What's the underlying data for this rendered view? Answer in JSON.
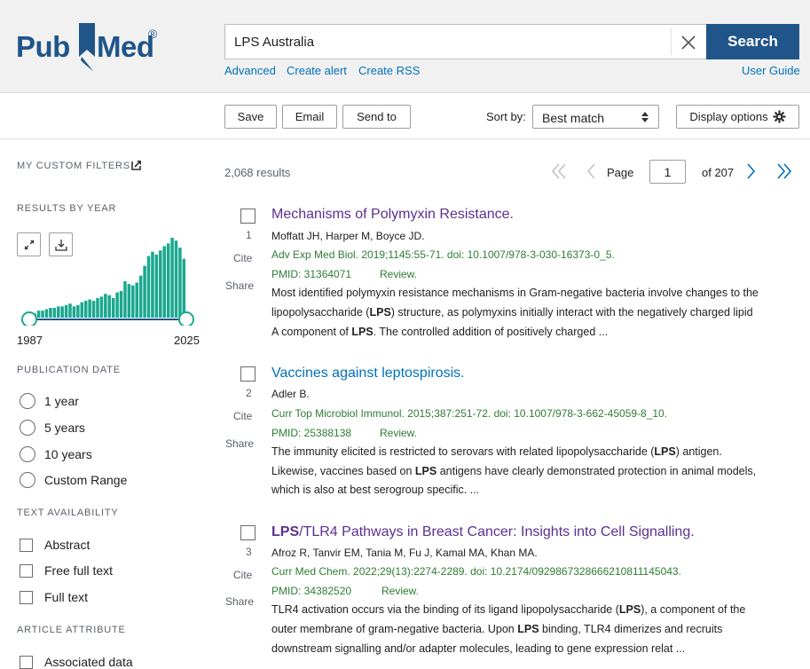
{
  "header": {
    "logo_pub": "Pub",
    "logo_med": "Med",
    "logo_reg": "®",
    "search_value": "LPS Australia",
    "search_button": "Search",
    "links": {
      "advanced": "Advanced",
      "create_alert": "Create alert",
      "create_rss": "Create RSS",
      "user_guide": "User Guide"
    }
  },
  "toolbar": {
    "save": "Save",
    "email": "Email",
    "send_to": "Send to",
    "sort_label": "Sort by:",
    "sort_value": "Best match",
    "display_options": "Display options"
  },
  "sidebar": {
    "custom_filters": "MY CUSTOM FILTERS",
    "results_by_year": "RESULTS BY YEAR",
    "year_start": "1987",
    "year_end": "2025",
    "publication_date": "PUBLICATION DATE",
    "date_options": [
      "1 year",
      "5 years",
      "10 years",
      "Custom Range"
    ],
    "text_availability": "TEXT AVAILABILITY",
    "text_options": [
      "Abstract",
      "Free full text",
      "Full text"
    ],
    "article_attribute": "ARTICLE ATTRIBUTE",
    "attribute_options": [
      "Associated data"
    ]
  },
  "chart_data": {
    "type": "bar",
    "color": "#1aa88f",
    "values": [
      3,
      3,
      5,
      5,
      6,
      7,
      7,
      8,
      8,
      9,
      10,
      8,
      9,
      11,
      12,
      13,
      12,
      14,
      15,
      17,
      16,
      14,
      18,
      19,
      26,
      24,
      23,
      25,
      30,
      37,
      44,
      47,
      45,
      48,
      51,
      53,
      57,
      55,
      50,
      42
    ]
  },
  "results": {
    "count": "2,068 results",
    "page_label": "Page",
    "page_value": "1",
    "page_of": "of 207",
    "cite_label": "Cite",
    "share_label": "Share",
    "items": [
      {
        "num": "1",
        "title": "Mechanisms of Polymyxin Resistance.",
        "authors": "Moffatt JH, Harper M, Boyce JD.",
        "citation": "Adv Exp Med Biol. 2019;1145:55-71. doi: 10.1007/978-3-030-16373-0_5.",
        "pmid": "PMID: 31364071",
        "type": "Review.",
        "snippet_1_a": "Most identified polymyxin resistance mechanisms in Gram-negative bacteria involve changes to the",
        "snippet_2_a": "lipopolysaccharide (",
        "snippet_2_b": "LPS",
        "snippet_2_c": ") structure, as polymyxins initially interact with the negatively charged lipid",
        "snippet_3_a": "A component of ",
        "snippet_3_b": "LPS",
        "snippet_3_c": ". The controlled addition of positively charged ..."
      },
      {
        "num": "2",
        "title": "Vaccines against leptospirosis.",
        "authors": "Adler B.",
        "citation": "Curr Top Microbiol Immunol. 2015;387:251-72. doi: 10.1007/978-3-662-45059-8_10.",
        "pmid": "PMID: 25388138",
        "type": "Review.",
        "snippet_1_a": "The immunity elicited is restricted to serovars with related lipopolysaccharide (",
        "snippet_1_b": "LPS",
        "snippet_1_c": ") antigen.",
        "snippet_2_a": "Likewise, vaccines based on ",
        "snippet_2_b": "LPS",
        "snippet_2_c": " antigens have clearly demonstrated protection in animal models,",
        "snippet_3_a": "which is also at best serogroup specific. ..."
      },
      {
        "num": "3",
        "title_bold": "LPS",
        "title_rest": "/TLR4 Pathways in Breast Cancer: Insights into Cell Signalling.",
        "authors": "Afroz R, Tanvir EM, Tania M, Fu J, Kamal MA, Khan MA.",
        "citation": "Curr Med Chem. 2022;29(13):2274-2289. doi: 10.2174/0929867328666210811145043.",
        "pmid": "PMID: 34382520",
        "type": "Review.",
        "snippet_1_a": "TLR4 activation occurs via the binding of its ligand lipopolysaccharide (",
        "snippet_1_b": "LPS",
        "snippet_1_c": "), a component of the",
        "snippet_2_a": "outer membrane of gram-negative bacteria. Upon ",
        "snippet_2_b": "LPS",
        "snippet_2_c": " binding, TLR4 dimerizes and recruits",
        "snippet_3_a": "downstream signalling and/or adapter molecules, leading to gene expression relat ..."
      }
    ]
  }
}
